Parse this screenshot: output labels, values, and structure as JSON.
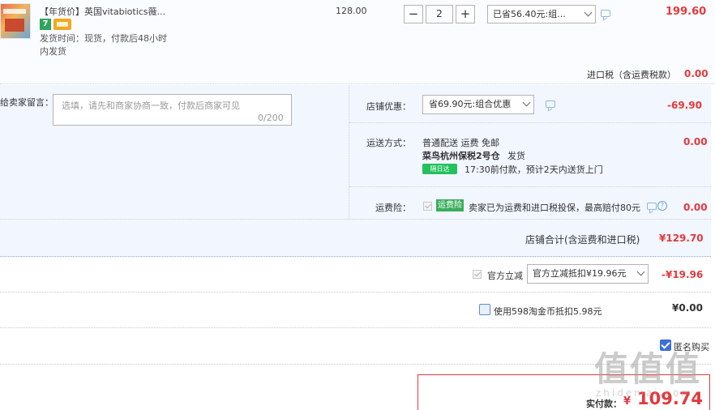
{
  "product": {
    "title": "【年货价】英国vitabiotics薇...",
    "badge_num": "7",
    "ship_time": "发货时间：现货，付款后48小时",
    "ship_time2": "内发货",
    "unit_price": "128.00",
    "qty_minus": "−",
    "qty_value": "2",
    "qty_plus": "+",
    "promo": "已省56.40元:组...",
    "row_total": "199.60",
    "tax_label": "进口税（含运费税款）",
    "tax_value": "0.00"
  },
  "shop": {
    "msg_label": "给卖家留言：",
    "msg_placeholder": "选填，请先和商家协商一致，付款后商家可见",
    "msg_count": "0/200",
    "coupon_label": "店铺优惠：",
    "coupon_select": "省69.90元:组合优惠",
    "coupon_value": "-69.90",
    "ship_label": "运送方式：",
    "ship_method": "普通配送 运费 免邮",
    "warehouse": "菜鸟杭州保税2号仓",
    "warehouse_suffix": "发货",
    "nextday_tag": "隔日达",
    "delivery_note": "17:30前付款，预计2天内送货上门",
    "ship_value": "0.00",
    "insurance_label": "运费险：",
    "insurance_tag": "运费险",
    "insurance_text": "卖家已为运费和进口税投保，最高赔付80元",
    "insurance_value": "0.00",
    "help_glyph": "?",
    "total_label": "店铺合计(含运费和进口税)",
    "total_value": "¥129.70"
  },
  "discounts": {
    "official_label": "官方立减",
    "official_select": "官方立减抵扣¥19.96元",
    "official_value": "-¥19.96",
    "coin_label": "使用598淘金币抵扣5.98元",
    "coin_value": "¥0.00",
    "anon_label": "匿名购买"
  },
  "payment": {
    "label": "实付款：",
    "currency": "¥",
    "amount": "109.74"
  },
  "watermark": {
    "main": "值值值",
    "sub": "zhidemai.com"
  },
  "colors": {
    "accent_red": "#e4393c",
    "section_bg": "#f2f6ff",
    "checkbox_blue": "#3a6fd8",
    "tag_green": "#22c05f"
  }
}
